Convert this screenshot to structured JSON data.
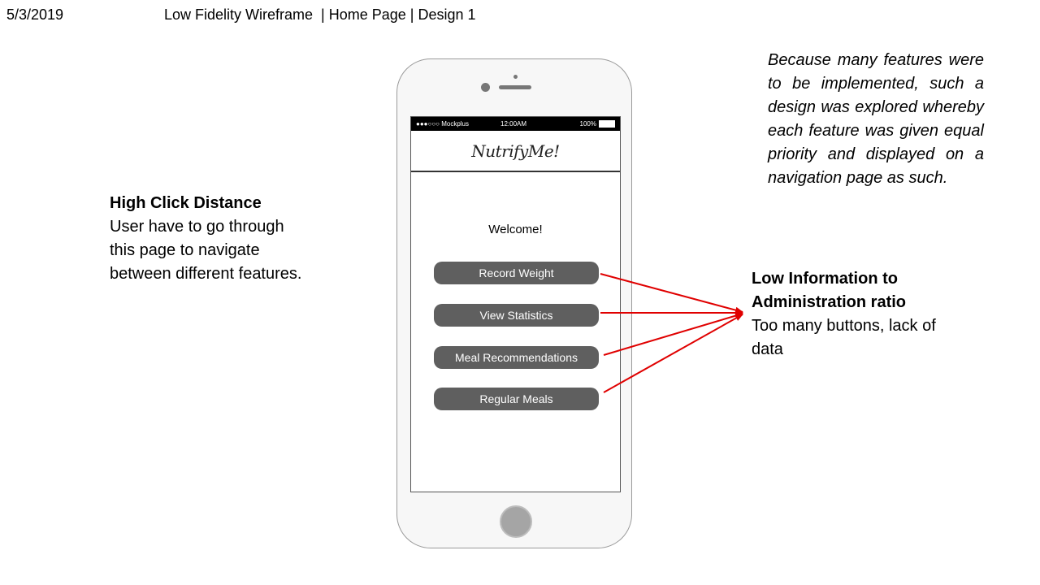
{
  "header": {
    "date": "5/3/2019",
    "title": "Low Fidelity Wireframe  | Home Page | Design 1"
  },
  "note_left": {
    "heading": "High Click Distance",
    "body": "User have to go through this page to navigate between different features."
  },
  "note_right": {
    "heading_line1": "Low Information to",
    "heading_line2": "Administration ratio",
    "body": "Too many buttons, lack of data"
  },
  "description": "Because many features were to be implemented, such a design was explored whereby each feature was given equal priority and displayed on a navigation page as such.",
  "phone": {
    "status": {
      "carrier": "●●●○○○ Mockplus",
      "time": "12:00AM",
      "battery": "100%"
    },
    "app_title": "NutrifyMe!",
    "welcome": "Welcome!",
    "buttons": [
      {
        "label": "Record Weight"
      },
      {
        "label": "View Statistics"
      },
      {
        "label": "Meal Recommendations"
      },
      {
        "label": "Regular Meals"
      }
    ]
  },
  "colors": {
    "button": "#5f5f5f",
    "arrow": "#e00000"
  }
}
